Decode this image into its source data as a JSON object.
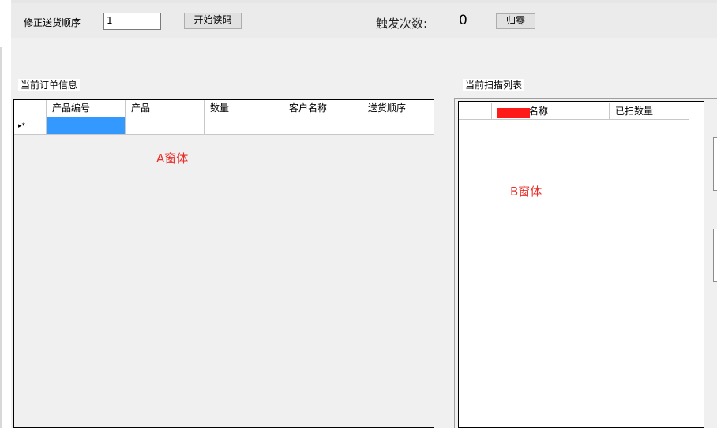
{
  "toolbar": {
    "fix_order_label": "修正送货顺序",
    "fix_order_value": "1",
    "start_read_button": "开始读码",
    "trigger_count_label": "触发次数:",
    "trigger_count_value": "0",
    "reset_button": "归零"
  },
  "order_panel": {
    "title": "当前订单信息",
    "columns": [
      "产品编号",
      "产品",
      "数量",
      "客户名称",
      "送货顺序"
    ],
    "new_row_marker": "▸*",
    "annotation": "A窗体"
  },
  "scan_panel": {
    "title": "当前扫描列表",
    "columns": [
      "名称",
      "已扫数量"
    ],
    "annotation": "B窗体"
  },
  "colors": {
    "annotation": "#e8302a",
    "selected_cell": "#3399ff",
    "redaction": "#ff1a1a"
  }
}
